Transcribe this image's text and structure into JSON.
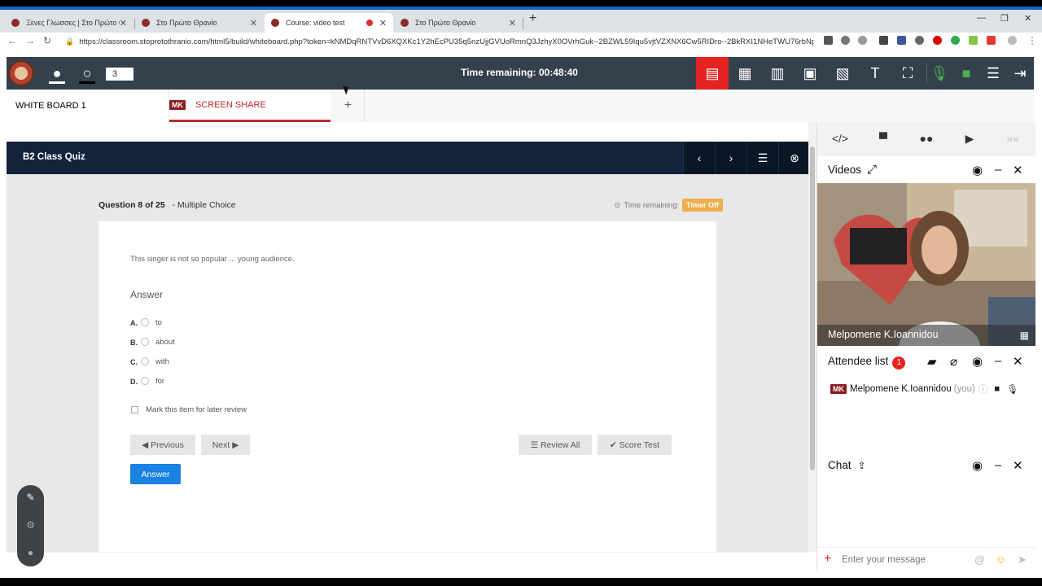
{
  "browser": {
    "tabs": [
      {
        "title": "Ξενες Γλωσσες | Στο Πρώτο Θρα...",
        "active": false
      },
      {
        "title": "Στο Πρώτο Θρανίο",
        "active": false
      },
      {
        "title": "Course: video test",
        "active": true,
        "recording": true
      },
      {
        "title": "Στο Πρώτο Θρανίο",
        "active": false
      }
    ],
    "url": "https://classroom.stoprotothranio.com/html5/build/whiteboard.php?token=kNMDqRNTVvD6XQXKc1Y2hEcPU35q5nzUjjGVUoRmnQ3JzhyX0OVrhGuk--2BZWL59Iqu5vjtVZXNX6Cw5RIDro--2BkRXI1NHeTWU76rbNpcNWa..."
  },
  "header": {
    "page_number": "3",
    "timer": "Time remaining: 00:48:40"
  },
  "whiteboard_tabs": {
    "tab1": "WHITE BOARD 1",
    "tab2_badge": "MK",
    "tab2": "SCREEN SHARE",
    "add": "+"
  },
  "quiz": {
    "title": "B2 Class Quiz",
    "question_counter": "Question 8 of 25",
    "question_type": "- Multiple Choice",
    "time_label": "Time remaining:",
    "timer_status": "Timer Off",
    "question": "This singer is not so popular ... young audience.",
    "answer_label": "Answer",
    "options": [
      {
        "letter": "A.",
        "text": "to"
      },
      {
        "letter": "B.",
        "text": "about"
      },
      {
        "letter": "C.",
        "text": "with"
      },
      {
        "letter": "D.",
        "text": "for"
      }
    ],
    "mark_review": "Mark this item for later review",
    "prev_label": "Previous",
    "next_label": "Next",
    "review_all_label": "Review All",
    "score_test_label": "Score Test",
    "answer_button": "Answer"
  },
  "panel": {
    "videos_title": "Videos",
    "video_name": "Melpomene K.Ioannidou",
    "attendee_title": "Attendee list",
    "attendee_count": "1",
    "attendee_badge": "MK",
    "attendee_name": "Melpomene K.Ioannidou",
    "attendee_you": "(you)",
    "chat_title": "Chat",
    "chat_placeholder": "Enter your message"
  },
  "colors": {
    "header_bg": "#34404c",
    "quiz_bar": "#13243a",
    "accent_red": "#e52421",
    "answer_blue": "#1a82e2",
    "timer_off": "#f0ad4e"
  }
}
